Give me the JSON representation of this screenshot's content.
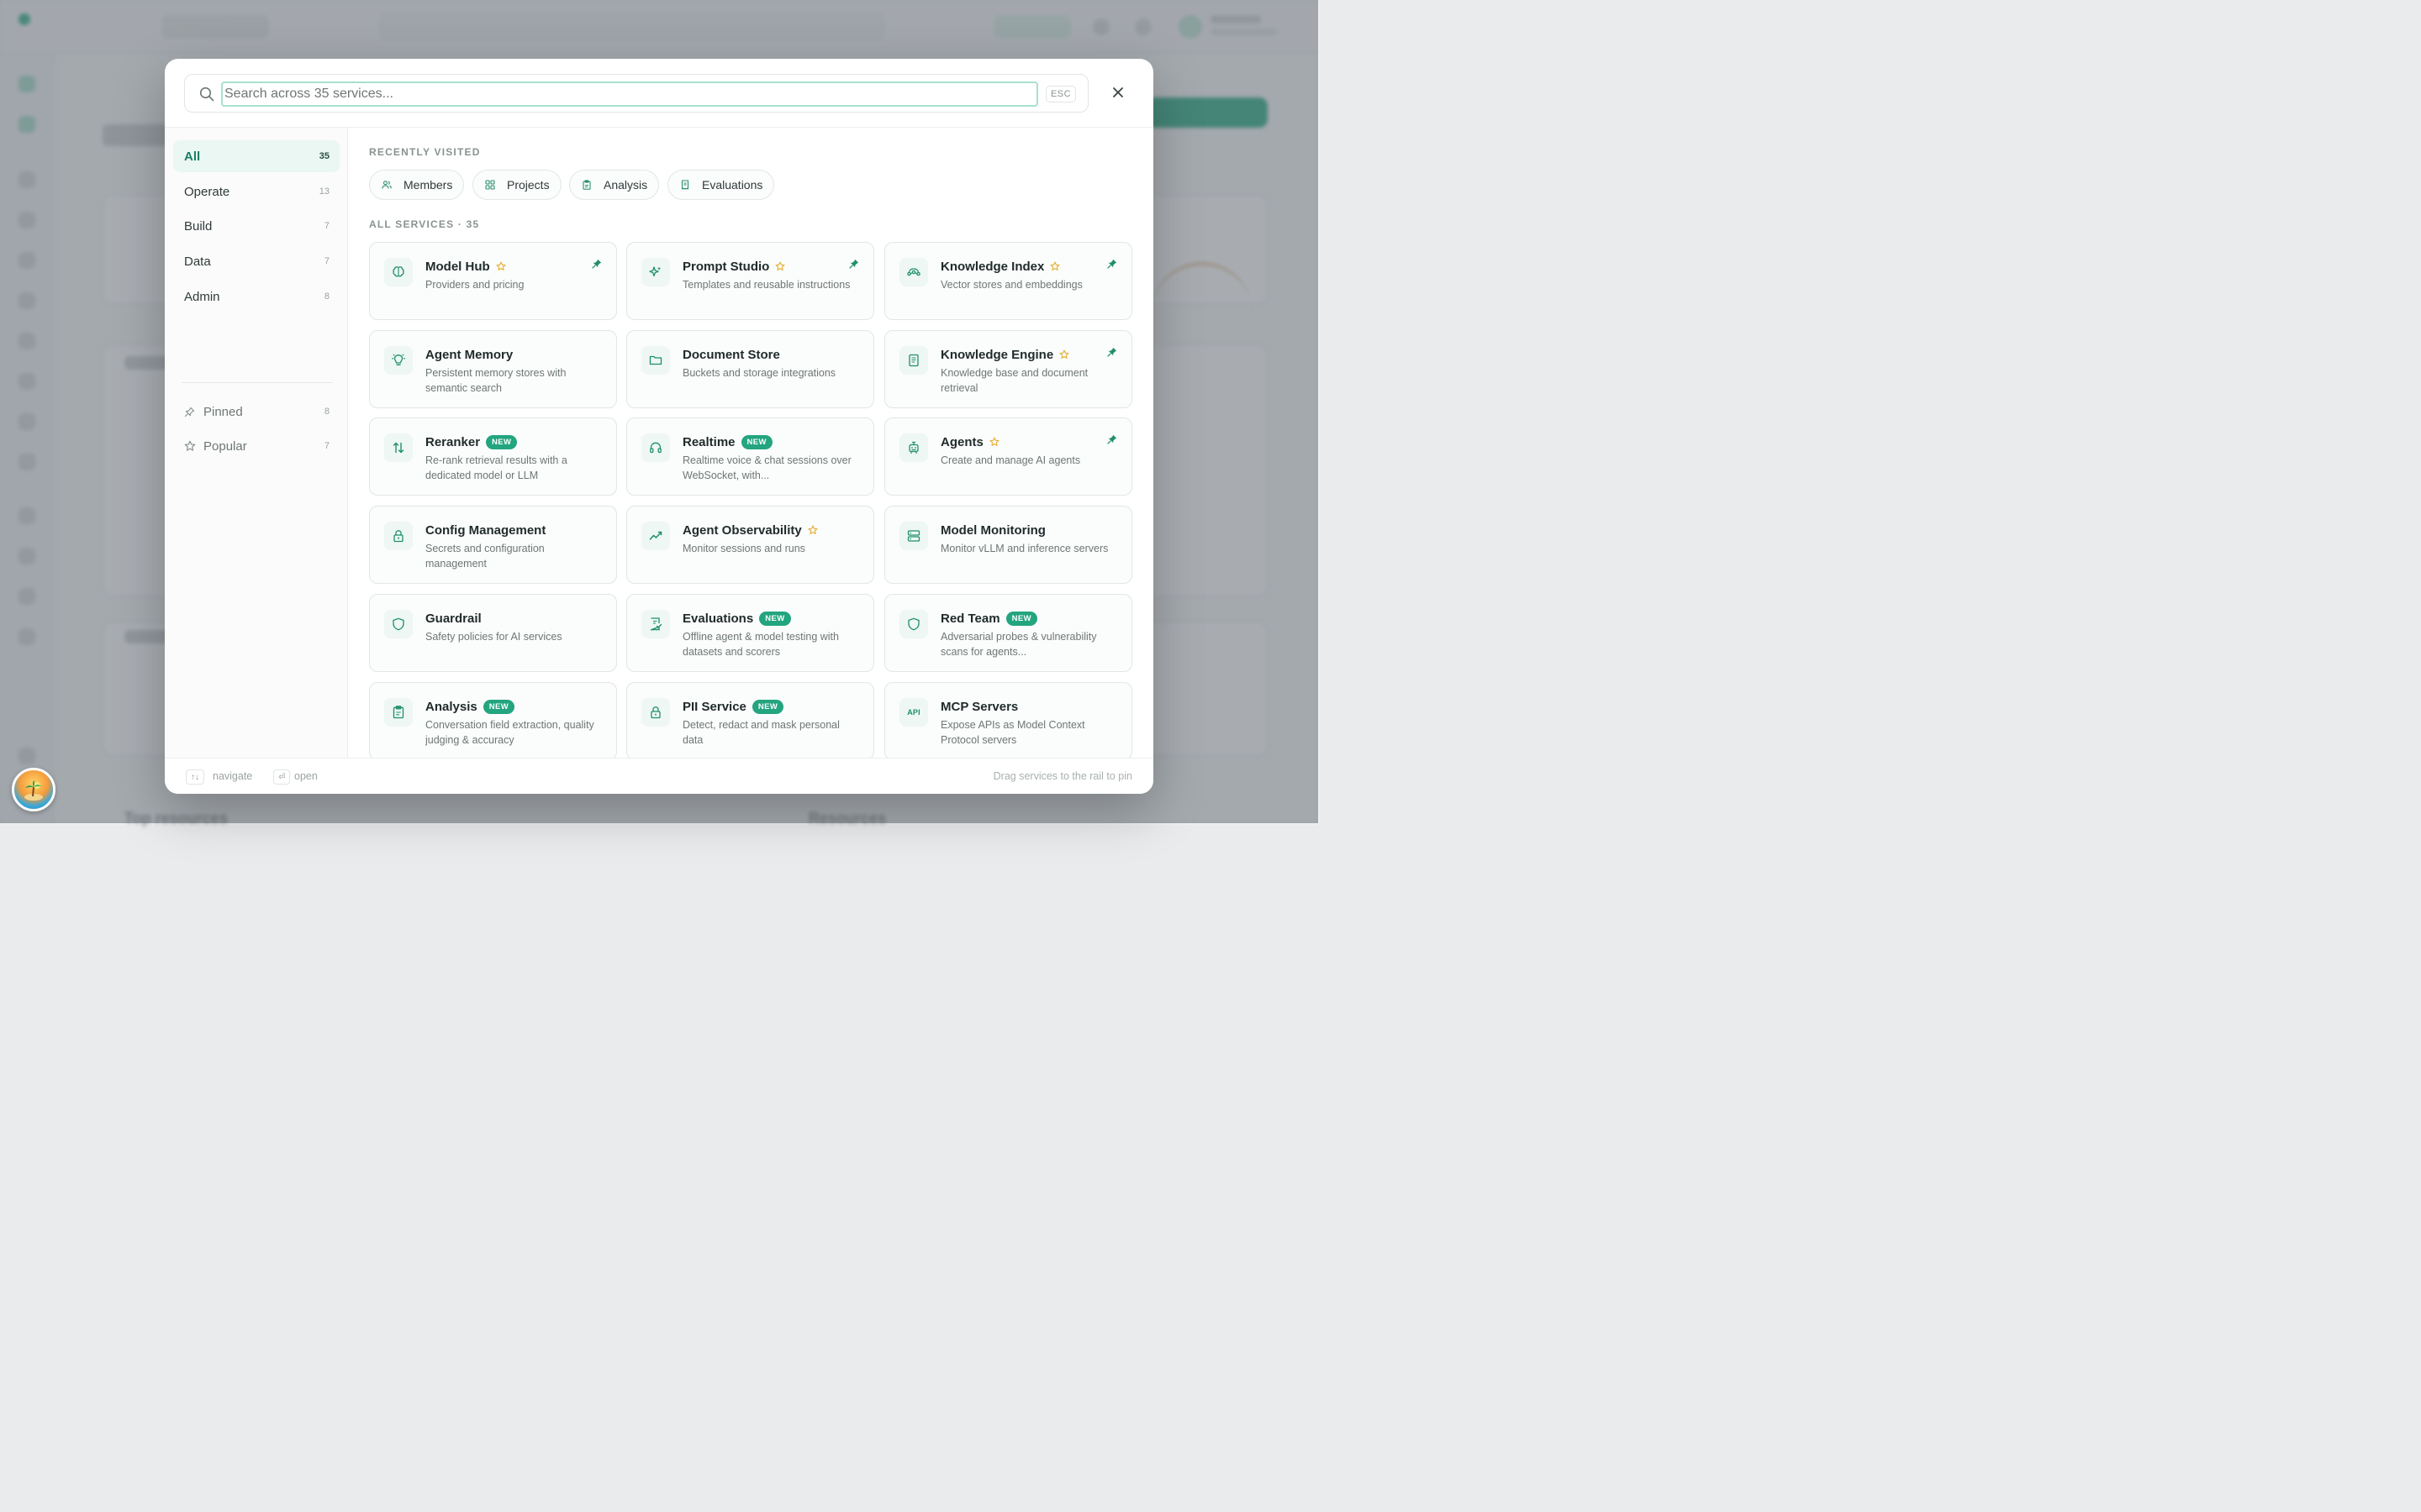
{
  "background": {
    "top_resources_heading": "Top resources",
    "resources_heading": "Resources"
  },
  "search": {
    "placeholder": "Search across 35 services...",
    "esc_label": "ESC"
  },
  "sidebar": {
    "categories": [
      {
        "label": "All",
        "count": "35"
      },
      {
        "label": "Operate",
        "count": "13"
      },
      {
        "label": "Build",
        "count": "7"
      },
      {
        "label": "Data",
        "count": "7"
      },
      {
        "label": "Admin",
        "count": "8"
      }
    ],
    "filters": [
      {
        "label": "Pinned",
        "count": "8",
        "icon": "pin-icon"
      },
      {
        "label": "Popular",
        "count": "7",
        "icon": "star-icon"
      }
    ]
  },
  "recent": {
    "heading": "RECENTLY VISITED",
    "items": [
      {
        "label": "Members",
        "icon": "users-icon"
      },
      {
        "label": "Projects",
        "icon": "grid-icon"
      },
      {
        "label": "Analysis",
        "icon": "clipboard-icon"
      },
      {
        "label": "Evaluations",
        "icon": "receipt-icon"
      }
    ]
  },
  "services": {
    "heading": "ALL SERVICES · 35",
    "new_label": "NEW",
    "items": [
      {
        "title": "Model Hub",
        "desc": "Providers and pricing",
        "icon": "brain-icon",
        "starred": true,
        "pinned": true,
        "is_new": false
      },
      {
        "title": "Prompt Studio",
        "desc": "Templates and reusable instructions",
        "icon": "sparkles-icon",
        "starred": true,
        "pinned": true,
        "is_new": false
      },
      {
        "title": "Knowledge Index",
        "desc": "Vector stores and embeddings",
        "icon": "vector-icon",
        "starred": true,
        "pinned": true,
        "is_new": false
      },
      {
        "title": "Agent Memory",
        "desc": "Persistent memory stores with semantic search",
        "icon": "lightbulb-icon",
        "starred": false,
        "pinned": false,
        "is_new": false
      },
      {
        "title": "Document Store",
        "desc": "Buckets and storage integrations",
        "icon": "folder-icon",
        "starred": false,
        "pinned": false,
        "is_new": false
      },
      {
        "title": "Knowledge Engine",
        "desc": "Knowledge base and document retrieval",
        "icon": "book-icon",
        "starred": true,
        "pinned": true,
        "is_new": false
      },
      {
        "title": "Reranker",
        "desc": "Re-rank retrieval results with a dedicated model or LLM",
        "icon": "arrows-up-down-icon",
        "starred": false,
        "pinned": false,
        "is_new": true
      },
      {
        "title": "Realtime",
        "desc": "Realtime voice & chat sessions over WebSocket, with...",
        "icon": "headphones-icon",
        "starred": false,
        "pinned": false,
        "is_new": true
      },
      {
        "title": "Agents",
        "desc": "Create and manage AI agents",
        "icon": "robot-icon",
        "starred": true,
        "pinned": true,
        "is_new": false
      },
      {
        "title": "Config Management",
        "desc": "Secrets and configuration management",
        "icon": "lock-icon",
        "starred": false,
        "pinned": false,
        "is_new": false
      },
      {
        "title": "Agent Observability",
        "desc": "Monitor sessions and runs",
        "icon": "trend-icon",
        "starred": true,
        "pinned": false,
        "is_new": false
      },
      {
        "title": "Model Monitoring",
        "desc": "Monitor vLLM and inference servers",
        "icon": "server-icon",
        "starred": false,
        "pinned": false,
        "is_new": false
      },
      {
        "title": "Guardrail",
        "desc": "Safety policies for AI services",
        "icon": "shield-icon",
        "starred": false,
        "pinned": false,
        "is_new": false
      },
      {
        "title": "Evaluations",
        "desc": "Offline agent & model testing with datasets and scorers",
        "icon": "receipt-check-icon",
        "starred": false,
        "pinned": false,
        "is_new": true
      },
      {
        "title": "Red Team",
        "desc": "Adversarial probes & vulnerability scans for agents...",
        "icon": "shield-icon",
        "starred": false,
        "pinned": false,
        "is_new": true
      },
      {
        "title": "Analysis",
        "desc": "Conversation field extraction, quality judging & accuracy",
        "icon": "clipboard-icon",
        "starred": false,
        "pinned": false,
        "is_new": true
      },
      {
        "title": "PII Service",
        "desc": "Detect, redact and mask personal data",
        "icon": "lock-icon",
        "starred": false,
        "pinned": false,
        "is_new": true
      },
      {
        "title": "MCP Servers",
        "desc": "Expose APIs as Model Context Protocol servers",
        "icon": "api-icon",
        "icon_text": "API",
        "starred": false,
        "pinned": false,
        "is_new": false
      }
    ]
  },
  "footer": {
    "navigate_kbd": "↑↓",
    "navigate_label": "navigate",
    "open_kbd": "⏎",
    "open_label": "open",
    "hint": "Drag services to the rail to pin"
  },
  "colors": {
    "accent": "#23a57f",
    "accent_dark": "#1b7f62",
    "star": "#e6b33c",
    "pin": "#1e8f6c"
  }
}
